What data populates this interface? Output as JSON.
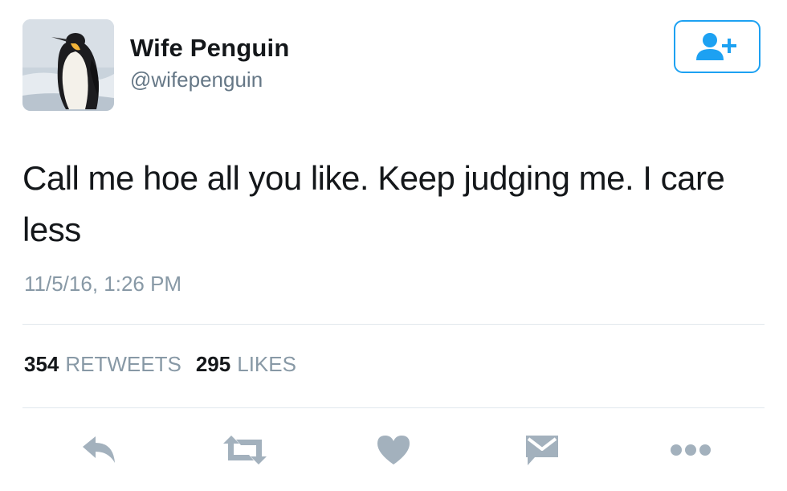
{
  "user": {
    "name": "Wife Penguin",
    "handle": "@wifepenguin"
  },
  "tweet": {
    "text": "Call me hoe all you like. Keep judging me. I care less",
    "timestamp": "11/5/16, 1:26 PM"
  },
  "stats": {
    "retweets_count": "354",
    "retweets_label": "RETWEETS",
    "likes_count": "295",
    "likes_label": "LIKES"
  },
  "icons": {
    "follow": "add-user-icon",
    "reply": "reply-icon",
    "retweet": "retweet-icon",
    "like": "heart-icon",
    "dm": "envelope-icon",
    "more": "more-dots-icon"
  },
  "colors": {
    "accent": "#1da1f2",
    "secondary_text": "#8899a6",
    "icon_gray": "#a3b1bd",
    "divider": "#e1e8ed"
  }
}
